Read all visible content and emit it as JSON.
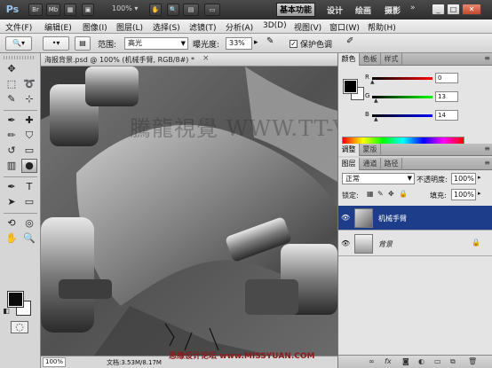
{
  "appbar": {
    "logo": "Ps",
    "buttons": [
      "Br",
      "Mb"
    ],
    "zoom": "100% ▾",
    "workspaces": {
      "active": "基本功能",
      "items": [
        "设计",
        "绘画",
        "摄影"
      ],
      "more": "»"
    },
    "window_buttons": [
      "_",
      "□",
      "✕"
    ]
  },
  "menu": [
    "文件(F)",
    "编辑(E)",
    "图像(I)",
    "图层(L)",
    "选择(S)",
    "滤镜(T)",
    "分析(A)",
    "3D(D)",
    "视图(V)",
    "窗口(W)",
    "帮助(H)"
  ],
  "options": {
    "range_label": "范围:",
    "range_value": "高光",
    "exposure_label": "曝光度:",
    "exposure_value": "33%",
    "protect_label": "保护色调",
    "protect_checked": "✓"
  },
  "document": {
    "tab_title": "海报背景.psd @ 100% (机械手臂, RGB/8#) *",
    "close": "×",
    "zoom": "100%",
    "doc_info": "文档:3.53M/8.17M",
    "watermark": "騰龍視覺 WWW.TT-VINET"
  },
  "footer_watermark": "思缘设计论坛 www.MISSYUAN.COM",
  "color_panel": {
    "tabs": [
      "颜色",
      "色板",
      "样式"
    ],
    "channels": [
      {
        "label": "R",
        "value": "0",
        "color": "#d00000"
      },
      {
        "label": "G",
        "value": "13",
        "color": "#00b000"
      },
      {
        "label": "B",
        "value": "14",
        "color": "#0010d0"
      }
    ]
  },
  "adjust_panel": {
    "tabs": [
      "调整",
      "蒙版"
    ]
  },
  "layers_panel": {
    "tabs": [
      "图层",
      "通道",
      "路径"
    ],
    "blend_mode": "正常",
    "opacity_label": "不透明度:",
    "opacity_value": "100%",
    "lock_label": "锁定:",
    "fill_label": "填充:",
    "fill_value": "100%",
    "layers": [
      {
        "name": "机械手臂",
        "selected": true
      },
      {
        "name": "背景",
        "selected": false,
        "locked": true
      }
    ],
    "footer_icons": [
      "link-icon",
      "fx-icon",
      "mask-icon",
      "adjustment-icon",
      "folder-icon",
      "new-layer-icon",
      "trash-icon"
    ]
  }
}
